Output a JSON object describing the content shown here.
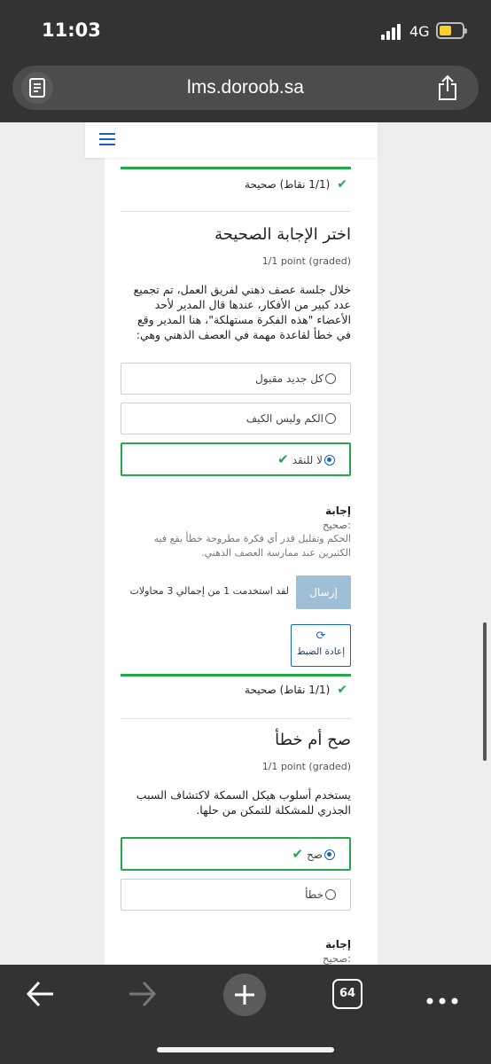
{
  "status_bar": {
    "time": "11:03",
    "network": "4G"
  },
  "browser": {
    "url": "lms.doroob.sa"
  },
  "question1": {
    "result": "(1/1 نقاط) صحيحة"
  },
  "question2": {
    "title": "اختر الإجابة الصحيحة",
    "points": "1/1 point (graded)",
    "text": "خلال جلسة عصف ذهني لفريق العمل، تم تجميع عدد كبير من الأفكار، عندها قال المدير لأحد الأعضاء \"هذه الفكرة مستهلكة\"، هنا المدير وقع في خطأ لقاعدة مهمة في العصف الذهني وهي:",
    "options": [
      "كل جديد مقبول",
      "الكم وليس الكيف",
      "لا للنقد"
    ],
    "answer_heading": "إجابة",
    "answer_label": "صحيح:",
    "answer_text": "الحكم وتقليل قدر أي فكرة مطروحة خطأ يقع فيه الكثيرين عند ممارسة العصف الذهني.",
    "submit_label": "إرسال",
    "attempts_text": "لقد استخدمت 1 من إجمالي 3 محاولات",
    "reset_label": "إعادة الضبط",
    "result": "(1/1 نقاط) صحيحة"
  },
  "question3": {
    "title": "صح أم خطأ",
    "points": "1/1 point (graded)",
    "text": "يستخدم أسلوب هيكل السمكة لاكتشاف السبب الجذري للمشكلة للتمكن من حلها.",
    "options": [
      "صح",
      "خطأ"
    ],
    "answer_heading": "إجابة",
    "answer_label": "صحيح:"
  },
  "toolbar": {
    "tab_count": "64"
  },
  "colors": {
    "correct": "#23a84a",
    "selected_radio": "#1565c0",
    "submit_bg": "#9ebfd6",
    "chrome": "#333333"
  }
}
